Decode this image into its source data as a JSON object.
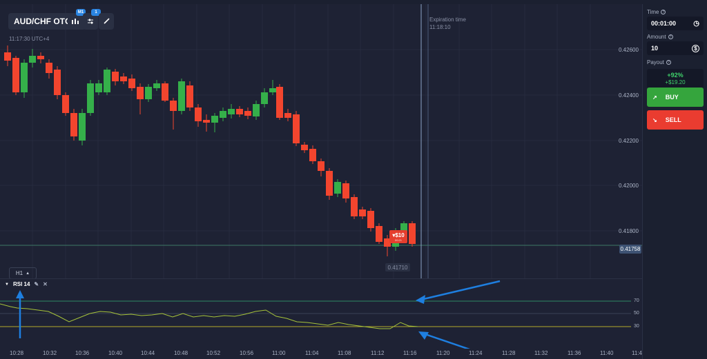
{
  "header": {
    "pair": "AUD/CHF OTC",
    "timeframe_badge": "M1",
    "indicator_badge": "1",
    "clock": "11:17:30 UTC+4"
  },
  "chart": {
    "expiration_label": "Expiration time",
    "expiration_time": "11:18:10",
    "price_labels": [
      "0.42600",
      "0.42400",
      "0.42200",
      "0.42000",
      "0.41800"
    ],
    "current_price": "0.41758",
    "low_label": "0.41710",
    "trade_amount": "▾$10",
    "trade_time": "00:21",
    "interval": "H1"
  },
  "rsi": {
    "title": "RSI 14",
    "levels": [
      "70",
      "50",
      "30"
    ]
  },
  "time_axis": [
    "10:28",
    "10:32",
    "10:36",
    "10:40",
    "10:44",
    "10:48",
    "10:52",
    "10:56",
    "11:00",
    "11:04",
    "11:08",
    "11:12",
    "11:16",
    "11:20",
    "11:24",
    "11:28",
    "11:32",
    "11:36",
    "11:40",
    "11:4"
  ],
  "sidebar": {
    "time_label": "Time",
    "time_value": "00:01:00",
    "amount_label": "Amount",
    "amount_value": "10",
    "payout_label": "Payout",
    "payout_pct": "+92%",
    "payout_amount": "+$19.20",
    "buy_label": "BUY",
    "sell_label": "SELL"
  },
  "colors": {
    "up": "#35b04a",
    "down": "#f3452e",
    "rsi_line": "#a7c43a",
    "accent": "#2a84e0"
  }
}
